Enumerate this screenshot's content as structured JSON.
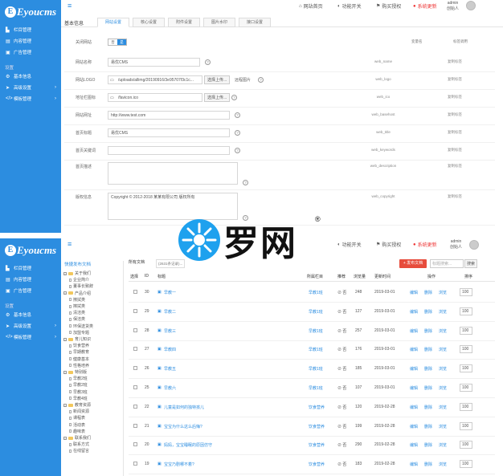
{
  "brand": "Eyoucms",
  "brand_initial": "E",
  "top": {
    "home": "网站首页",
    "func": "功能开关",
    "buy": "购买授权",
    "update": "系统更新",
    "user_name": "admin",
    "user_role": "创始人"
  },
  "sidebar": {
    "items_main": [
      {
        "icon": "column-icon",
        "glyph": "▙",
        "label": "栏目管理"
      },
      {
        "icon": "content-icon",
        "glyph": "▤",
        "label": "内容管理"
      },
      {
        "icon": "ad-icon",
        "glyph": "▣",
        "label": "广告管理"
      }
    ],
    "section": "设置",
    "items_settings": [
      {
        "icon": "gear-icon",
        "glyph": "⚙",
        "label": "基本信息"
      },
      {
        "icon": "send-icon",
        "glyph": "➤",
        "label": "高级设置",
        "chev": "›"
      },
      {
        "icon": "code-icon",
        "glyph": "</>",
        "label": "模板管理",
        "chev": "›"
      }
    ]
  },
  "settings": {
    "section_title": "基本信息",
    "tabs": [
      "网站设置",
      "核心设置",
      "附件设置",
      "图片水印",
      "接口设置"
    ],
    "hdr_var": "变量名",
    "hdr_tag": "标签调用",
    "close_label": "关闭网站",
    "toggle_off": "否",
    "toggle_on": "是",
    "fields": [
      {
        "label": "网站名称",
        "value": "易优CMS",
        "var": "web_name",
        "op": "复制标签"
      },
      {
        "label": "网站LOGO",
        "value": "/uploads/allimg/20190916/3e95707f3c1c...",
        "btn": "选择上传...",
        "note": "远程图片",
        "var": "web_logo",
        "op": "复制标签"
      },
      {
        "label": "地址栏图标",
        "value": "/favicon.ico",
        "btn": "选择上传...",
        "var": "web_ico",
        "op": "复制标签"
      },
      {
        "label": "网站网址",
        "value": "http://www.test.com",
        "var": "web_basehost",
        "op": "复制标签"
      },
      {
        "label": "首页标题",
        "value": "易优CMS",
        "var": "web_title",
        "op": "复制标签"
      },
      {
        "label": "首页关键词",
        "value": "",
        "var": "web_keywords",
        "op": "复制标签"
      },
      {
        "label": "首页描述",
        "value": "",
        "var": "web_description",
        "op": "复制标签"
      },
      {
        "label": "版权信息",
        "value": "Copyright © 2012-2018 某某有限公司 版权所有",
        "var": "web_copyright",
        "op": "复制标签"
      }
    ]
  },
  "articles": {
    "tree_title": "快捷发布文档",
    "crumb": "所有文档",
    "crumb_input": "(2631条记录)...",
    "add_btn": "+ 发布文档",
    "search_ph": "标题搜索...",
    "search_btn": "搜索",
    "tree": [
      {
        "label": "关于我们",
        "lvl": 0
      },
      {
        "label": "企业简介",
        "lvl": 1
      },
      {
        "label": "董事长致辞",
        "lvl": 1
      },
      {
        "label": "产品介绍",
        "lvl": 0
      },
      {
        "label": "擦拭类",
        "lvl": 1
      },
      {
        "label": "擦拭类",
        "lvl": 1
      },
      {
        "label": "清洁类",
        "lvl": 1
      },
      {
        "label": "保洁类",
        "lvl": 1
      },
      {
        "label": "环保送货类",
        "lvl": 1
      },
      {
        "label": "加盟专题",
        "lvl": 1
      },
      {
        "label": "育儿知识",
        "lvl": 0
      },
      {
        "label": "饮食营养",
        "lvl": 1
      },
      {
        "label": "早期教育",
        "lvl": 1
      },
      {
        "label": "健康基本",
        "lvl": 1
      },
      {
        "label": "性格培养",
        "lvl": 1
      },
      {
        "label": "特别版",
        "lvl": 0
      },
      {
        "label": "早教2班",
        "lvl": 1
      },
      {
        "label": "早教2班",
        "lvl": 1
      },
      {
        "label": "早教3班",
        "lvl": 1
      },
      {
        "label": "早教4班",
        "lvl": 1
      },
      {
        "label": "教育资源",
        "lvl": 0
      },
      {
        "label": "新闻资源",
        "lvl": 1
      },
      {
        "label": "课程表",
        "lvl": 1
      },
      {
        "label": "活动表",
        "lvl": 1
      },
      {
        "label": "趣味表",
        "lvl": 1
      },
      {
        "label": "联系我们",
        "lvl": 0
      },
      {
        "label": "联系方式",
        "lvl": 1
      },
      {
        "label": "在线留言",
        "lvl": 1
      }
    ],
    "headers": [
      "选择",
      "ID",
      "标题",
      "所属栏目",
      "推荐",
      "浏览量",
      "更新时间",
      "操作",
      "排序"
    ],
    "rows": [
      {
        "id": "30",
        "title": "早教一",
        "cat": "早教1班",
        "rec": "否",
        "views": "248",
        "date": "2019-03-01",
        "sort": "100"
      },
      {
        "id": "29",
        "title": "早教二",
        "cat": "早教1班",
        "rec": "否",
        "views": "127",
        "date": "2019-03-01",
        "sort": "100"
      },
      {
        "id": "28",
        "title": "早教三",
        "cat": "早教1班",
        "rec": "否",
        "views": "257",
        "date": "2019-03-01",
        "sort": "100"
      },
      {
        "id": "27",
        "title": "早教四",
        "cat": "早教1班",
        "rec": "否",
        "views": "176",
        "date": "2019-03-01",
        "sort": "100"
      },
      {
        "id": "26",
        "title": "早教五",
        "cat": "早教1班",
        "rec": "否",
        "views": "185",
        "date": "2019-03-01",
        "sort": "100"
      },
      {
        "id": "25",
        "title": "早教六",
        "cat": "早教1班",
        "rec": "否",
        "views": "107",
        "date": "2019-03-01",
        "sort": "100"
      },
      {
        "id": "22",
        "title": "儿童是如何的独特孩儿",
        "cat": "饮食营养",
        "rec": "否",
        "views": "120",
        "date": "2019-02-28",
        "sort": "100"
      },
      {
        "id": "21",
        "title": "宝宝为什么这么后悔?",
        "cat": "饮食营养",
        "rec": "否",
        "views": "199",
        "date": "2019-02-28",
        "sort": "100"
      },
      {
        "id": "20",
        "title": "妈妈，宝宝睡眠的原因仿守",
        "cat": "饮食营养",
        "rec": "否",
        "views": "290",
        "date": "2019-02-28",
        "sort": "100"
      },
      {
        "id": "19",
        "title": "宝宝乃剧哪不着?",
        "cat": "饮食营养",
        "rec": "否",
        "views": "183",
        "date": "2019-02-28",
        "sort": "100"
      },
      {
        "id": "18",
        "title": "还总是阴你叫放子才着着要",
        "cat": "饮食营养",
        "rec": "否",
        "views": "271",
        "date": "2019-02-28",
        "sort": "100"
      }
    ],
    "ops": [
      "编辑",
      "删除",
      "浏览"
    ]
  },
  "watermark": {
    "text": "罗网",
    "reg": "®"
  },
  "colors": {
    "brand_blue": "#2c8de0",
    "danger": "#e74c3c"
  }
}
